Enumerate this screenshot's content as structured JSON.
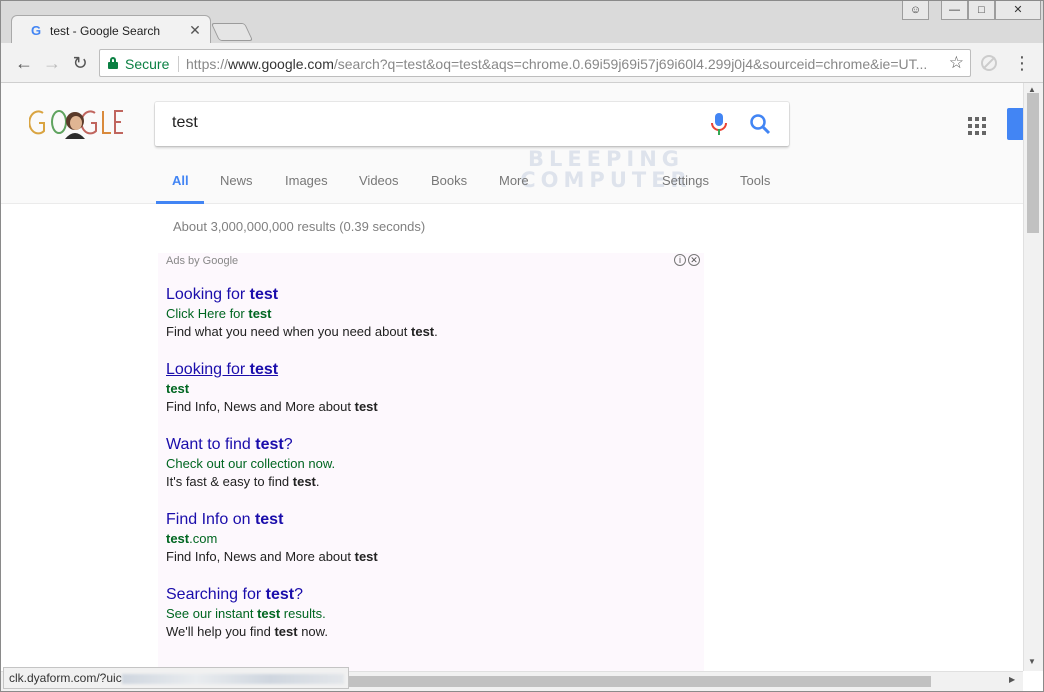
{
  "browser": {
    "tab_title": "test - Google Search",
    "secure_label": "Secure",
    "url_scheme": "https://",
    "url_host": "www.google.com",
    "url_path": "/search?q=test&oq=test&aqs=chrome.0.69i59j69i57j69i60l4.299j0j4&sourceid=chrome&ie=UT..."
  },
  "search": {
    "query": "test",
    "tabs": [
      "All",
      "News",
      "Images",
      "Videos",
      "Books",
      "More",
      "Settings",
      "Tools"
    ],
    "active_tab": "All",
    "result_stats": "About 3,000,000,000 results (0.39 seconds)"
  },
  "watermark": {
    "line1": "BLEEPING",
    "line2": "COMPUTER"
  },
  "ads": {
    "label": "Ads by Google",
    "items": [
      {
        "title_pre": "Looking for ",
        "title_bold": "test",
        "title_post": "",
        "display_pre": "Click Here for ",
        "display_bold": "test",
        "display_post": "",
        "desc_pre": "Find what you need when you need about ",
        "desc_bold": "test",
        "desc_post": "."
      },
      {
        "title_pre": "Looking for ",
        "title_bold": "test",
        "title_post": "",
        "display_pre": "",
        "display_bold": "test",
        "display_post": "",
        "desc_pre": "Find Info, News and More about ",
        "desc_bold": "test",
        "desc_post": ""
      },
      {
        "title_pre": "Want to find ",
        "title_bold": "test",
        "title_post": "?",
        "display_pre": "Check out our collection now.",
        "display_bold": "",
        "display_post": "",
        "desc_pre": "It's fast & easy to find ",
        "desc_bold": "test",
        "desc_post": "."
      },
      {
        "title_pre": "Find Info on ",
        "title_bold": "test",
        "title_post": "",
        "display_pre": "",
        "display_bold": "test",
        "display_post": ".com",
        "desc_pre": "Find Info, News and More about ",
        "desc_bold": "test",
        "desc_post": ""
      },
      {
        "title_pre": "Searching for ",
        "title_bold": "test",
        "title_post": "?",
        "display_pre": "See our instant ",
        "display_bold": "test",
        "display_post": " results.",
        "desc_pre": "We'll help you find ",
        "desc_bold": "test",
        "desc_post": " now."
      }
    ]
  },
  "status_bar": {
    "url_prefix": "clk.dyaform.com/?uic"
  },
  "colors": {
    "accent_blue": "#4285f4",
    "ad_title": "#1a0dab",
    "ad_display_url": "#006621",
    "secure_green": "#0b8043"
  },
  "icons": [
    "google-favicon-icon",
    "back-icon",
    "forward-icon",
    "reload-icon",
    "lock-icon",
    "star-icon",
    "blocked-extension-icon",
    "menu-icon",
    "microphone-icon",
    "search-icon",
    "apps-grid-icon",
    "info-icon",
    "close-icon"
  ]
}
